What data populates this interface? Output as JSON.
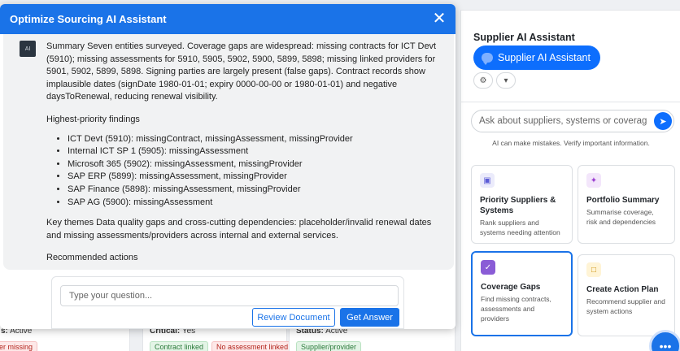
{
  "assistant": {
    "title": "Optimize Sourcing AI Assistant",
    "close_icon": "close-icon",
    "avatar_label": "AI",
    "summary": "Summary Seven entities surveyed. Coverage gaps are widespread: missing contracts for ICT Devt (5910); missing assessments for 5910, 5905, 5902, 5900, 5899, 5898; missing linked providers for 5901, 5902, 5899, 5898. Signing parties are largely present (false gaps). Contract records show implausible dates (signDate 1980-01-01; expiry 0000-00-00 or 1980-01-01) and negative daysToRenewal, reducing renewal visibility.",
    "findings_heading": "Highest-priority findings",
    "findings": [
      "ICT Devt (5910): missingContract, missingAssessment, missingProvider",
      "Internal ICT SP 1 (5905): missingAssessment",
      "Microsoft 365 (5902): missingAssessment, missingProvider",
      "SAP ERP (5899): missingAssessment, missingProvider",
      "SAP Finance (5898): missingAssessment, missingProvider",
      "SAP AG (5900): missingAssessment"
    ],
    "themes": "Key themes Data quality gaps and cross-cutting dependencies: placeholder/invalid renewal dates and missing assessments/providers across internal and external services.",
    "actions_heading": "Recommended actions",
    "input_placeholder": "Type your question...",
    "review_label": "Review Document",
    "answer_label": "Get Answer"
  },
  "background": {
    "cards": [
      {
        "status_label": "s:",
        "status_value": "Active",
        "tags": [
          {
            "text": "er missing",
            "tone": "red"
          }
        ]
      },
      {
        "critical_label": "Critical:",
        "critical_value": "Yes",
        "tags": [
          {
            "text": "Contract linked",
            "tone": "green"
          },
          {
            "text": "No assessment linked",
            "tone": "red"
          }
        ]
      },
      {
        "status_label": "Status:",
        "status_value": "Active",
        "tags": [
          {
            "text": "Supplier/provider",
            "tone": "green"
          }
        ]
      }
    ]
  },
  "supplier_panel": {
    "title": "Supplier AI Assistant",
    "pill_label": "Supplier AI Assistant",
    "settings_icon": "gear-icon",
    "dropdown_icon": "chevron-down-icon",
    "search_placeholder": "Ask about suppliers, systems or coverage...",
    "disclaimer": "AI can make mistakes. Verify important information.",
    "cards": [
      {
        "title": "Priority Suppliers & Systems",
        "desc": "Rank suppliers and systems needing attention",
        "icon": "priority-icon",
        "color": "#5b5bd6",
        "bg": "#ebebfb"
      },
      {
        "title": "Portfolio Summary",
        "desc": "Summarise coverage, risk and dependencies",
        "icon": "sparkle-icon",
        "color": "#9b3fd1",
        "bg": "#f3e6fb"
      },
      {
        "title": "Coverage Gaps",
        "desc": "Find missing contracts, assessments and providers",
        "icon": "check-icon",
        "color": "#ffffff",
        "bg": "#8a5cd6"
      },
      {
        "title": "Create Action Plan",
        "desc": "Recommend supplier and system actions",
        "icon": "plan-icon",
        "color": "#c98a00",
        "bg": "#fff4d6"
      }
    ]
  }
}
